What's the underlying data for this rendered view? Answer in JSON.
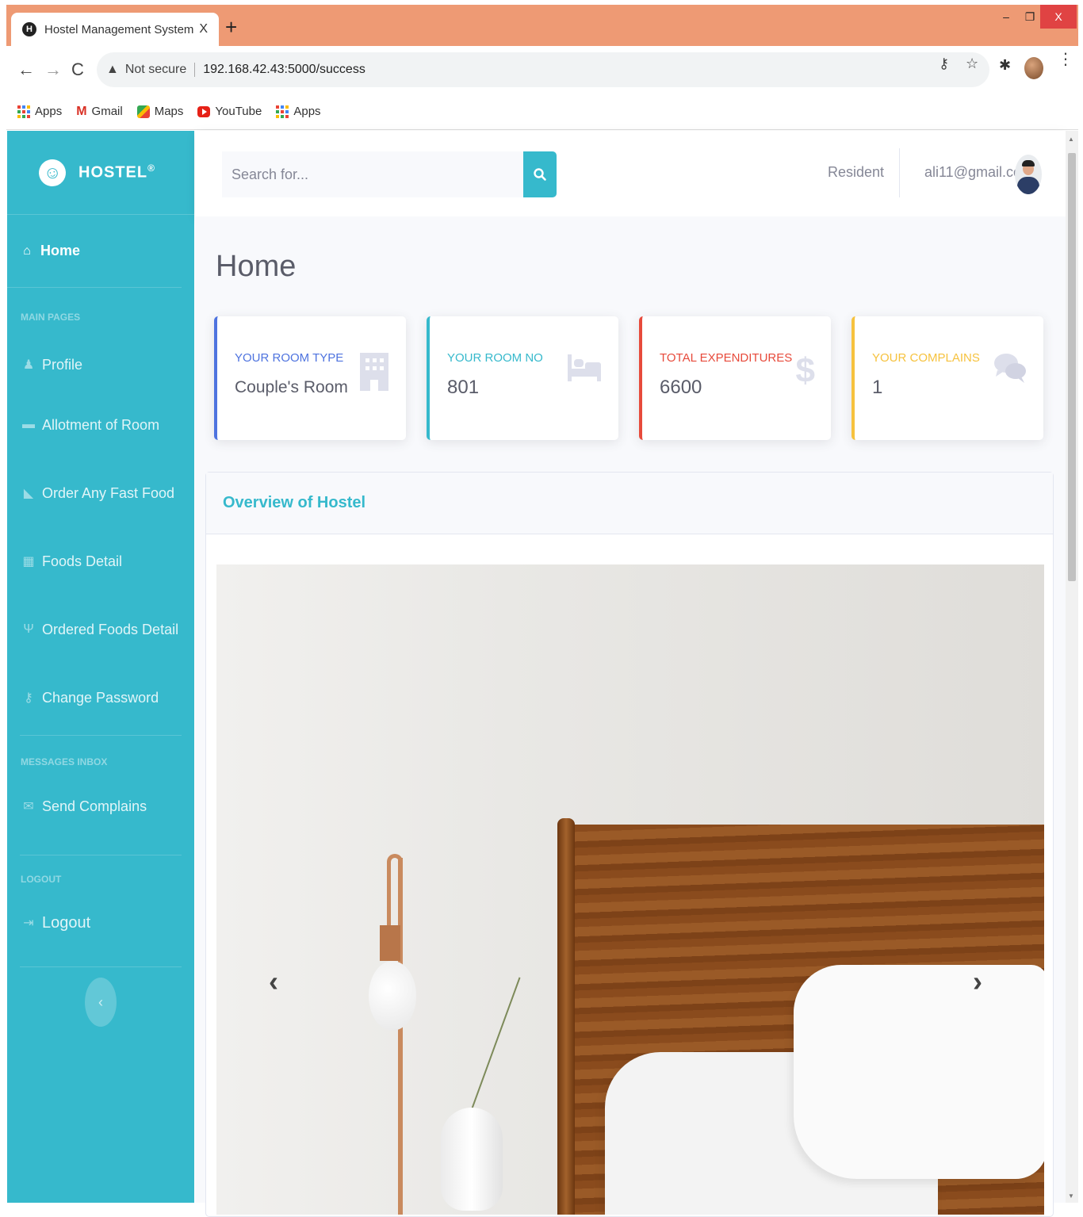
{
  "browser": {
    "tab_title": "Hostel Management System",
    "tab_close": "X",
    "new_tab": "+",
    "win_min": "–",
    "win_max": "❐",
    "win_close": "X",
    "not_secure": "Not secure",
    "url": "192.168.42.43:5000/success",
    "bookmarks": [
      {
        "label": "Apps",
        "icon": "apps-grid-icon"
      },
      {
        "label": "Gmail",
        "icon": "gmail-icon"
      },
      {
        "label": "Maps",
        "icon": "maps-icon"
      },
      {
        "label": "YouTube",
        "icon": "youtube-icon"
      },
      {
        "label": "Apps",
        "icon": "apps-grid-icon"
      }
    ]
  },
  "sidebar": {
    "brand": "HOSTEL",
    "brand_mark": "®",
    "home": "Home",
    "heading_main": "MAIN PAGES",
    "heading_messages": "MESSAGES INBOX",
    "heading_logout": "LOGOUT",
    "items": [
      {
        "label": "Profile",
        "icon": "user-icon"
      },
      {
        "label": "Allotment of Room",
        "icon": "bed-icon"
      },
      {
        "label": "Order Any Fast Food",
        "icon": "pizza-icon"
      },
      {
        "label": "Foods Detail",
        "icon": "table-icon"
      },
      {
        "label": "Ordered Foods Detail",
        "icon": "utensils-icon"
      },
      {
        "label": "Change Password",
        "icon": "key-icon"
      },
      {
        "label": "Send Complains",
        "icon": "envelope-icon"
      },
      {
        "label": "Logout",
        "icon": "sign-out-icon"
      }
    ],
    "toggle": "‹"
  },
  "topbar": {
    "search_placeholder": "Search for...",
    "role": "Resident",
    "email": "ali11@gmail.com"
  },
  "main": {
    "title": "Home",
    "cards": [
      {
        "label": "YOUR ROOM TYPE",
        "value": "Couple's Room",
        "icon": "building-icon"
      },
      {
        "label": "YOUR ROOM NO",
        "value": "801",
        "icon": "bed-icon"
      },
      {
        "label": "TOTAL EXPENDITURES",
        "value": "6600",
        "icon": "dollar-icon"
      },
      {
        "label": "YOUR COMPLAINS",
        "value": "1",
        "icon": "comments-icon"
      }
    ],
    "panel_title": "Overview of Hostel",
    "carousel_prev": "‹",
    "carousel_next": "›"
  },
  "colors": {
    "sidebar": "#36b9cc",
    "primary": "#4e73df",
    "info": "#36b9cc",
    "danger": "#e74a3b",
    "warning": "#f6c23e",
    "tabstrip": "#ee9a74"
  }
}
